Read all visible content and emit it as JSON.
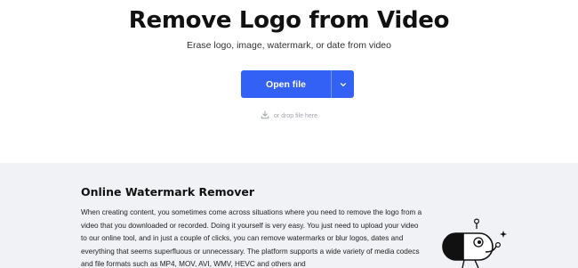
{
  "hero": {
    "title": "Remove Logo from Video",
    "subtitle": "Erase logo, image, watermark, or date from video",
    "open_button_label": "Open file",
    "dropdown_icon": "chevron-down-icon",
    "drop_icon": "download-icon",
    "drop_text": "or drop file here"
  },
  "section": {
    "title": "Online Watermark Remover",
    "body": "When creating content, you sometimes come across situations where you need to remove the logo from a video that you downloaded or recorded. Doing it yourself is very easy. You just need to upload your video to our online tool, and in just a couple of clicks, you can remove watermarks or blur logos, dates and everything that seems superfluous or unnecessary. The platform supports a wide variety of media codecs and file formats such as MP4, MOV, AVI, WMV, HEVC and others and"
  },
  "colors": {
    "accent": "#3360f5",
    "page_bg": "#ffffff",
    "section_bg": "#f0f2f5"
  },
  "illustration": "capsule-character-illustration"
}
